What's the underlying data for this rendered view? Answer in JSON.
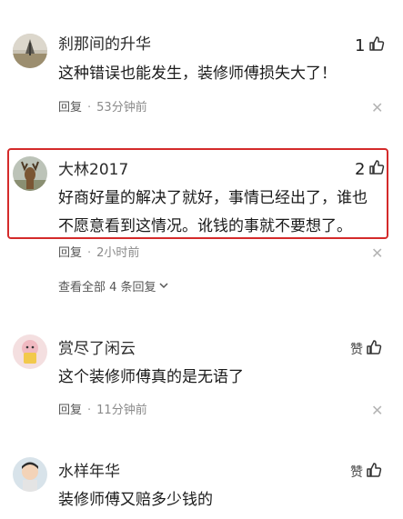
{
  "comments": [
    {
      "username": "刹那间的升华",
      "likes": "1",
      "text": "这种错误也能发生，装修师傅损失大了！",
      "reply": "回复",
      "time": "53分钟前"
    },
    {
      "username": "大林2017",
      "likes": "2",
      "text": "好商好量的解决了就好，事情已经出了，谁也不愿意看到这情况。讹钱的事就不要想了。",
      "reply": "回复",
      "time": "2小时前"
    },
    {
      "username": "赏尽了闲云",
      "likes": "赞",
      "text": "这个装修师傅真的是无语了",
      "reply": "回复",
      "time": "11分钟前"
    },
    {
      "username": "水样年华",
      "likes": "赞",
      "text": "装修师傅又赔多少钱的"
    }
  ],
  "view_all": "查看全部 4 条回复",
  "icons": {
    "like": "thumbs-up-icon",
    "close": "close-icon",
    "expand": "chevron-down-icon"
  },
  "colors": {
    "highlight_border": "#d42a2a",
    "meta_text": "#8a8a8a"
  }
}
